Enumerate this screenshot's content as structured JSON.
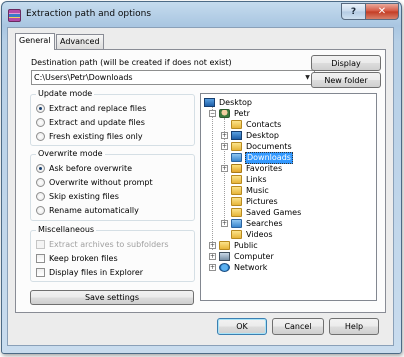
{
  "window": {
    "title": "Extraction path and options",
    "help_button": "?",
    "close_button": "✕"
  },
  "tabs": [
    {
      "label": "General",
      "active": true
    },
    {
      "label": "Advanced",
      "active": false
    }
  ],
  "destination": {
    "label": "Destination path (will be created if does not exist)",
    "value": "C:\\Users\\Petr\\Downloads"
  },
  "buttons": {
    "display": "Display",
    "new_folder": "New folder",
    "save_settings": "Save settings",
    "ok": "OK",
    "cancel": "Cancel",
    "help": "Help"
  },
  "update_mode": {
    "title": "Update mode",
    "options": [
      {
        "label": "Extract and replace files",
        "selected": true
      },
      {
        "label": "Extract and update files",
        "selected": false
      },
      {
        "label": "Fresh existing files only",
        "selected": false
      }
    ]
  },
  "overwrite_mode": {
    "title": "Overwrite mode",
    "options": [
      {
        "label": "Ask before overwrite",
        "selected": true
      },
      {
        "label": "Overwrite without prompt",
        "selected": false
      },
      {
        "label": "Skip existing files",
        "selected": false
      },
      {
        "label": "Rename automatically",
        "selected": false
      }
    ]
  },
  "miscellaneous": {
    "title": "Miscellaneous",
    "options": [
      {
        "label": "Extract archives to subfolders",
        "checked": false,
        "disabled": true
      },
      {
        "label": "Keep broken files",
        "checked": false,
        "disabled": false
      },
      {
        "label": "Display files in Explorer",
        "checked": false,
        "disabled": false
      }
    ]
  },
  "tree": {
    "root": "Desktop",
    "user": "Petr",
    "user_children": [
      "Contacts",
      "Desktop",
      "Documents",
      "Downloads",
      "Favorites",
      "Links",
      "Music",
      "Pictures",
      "Saved Games",
      "Searches",
      "Videos"
    ],
    "selected": "Downloads",
    "others": [
      "Public",
      "Computer",
      "Network"
    ]
  }
}
